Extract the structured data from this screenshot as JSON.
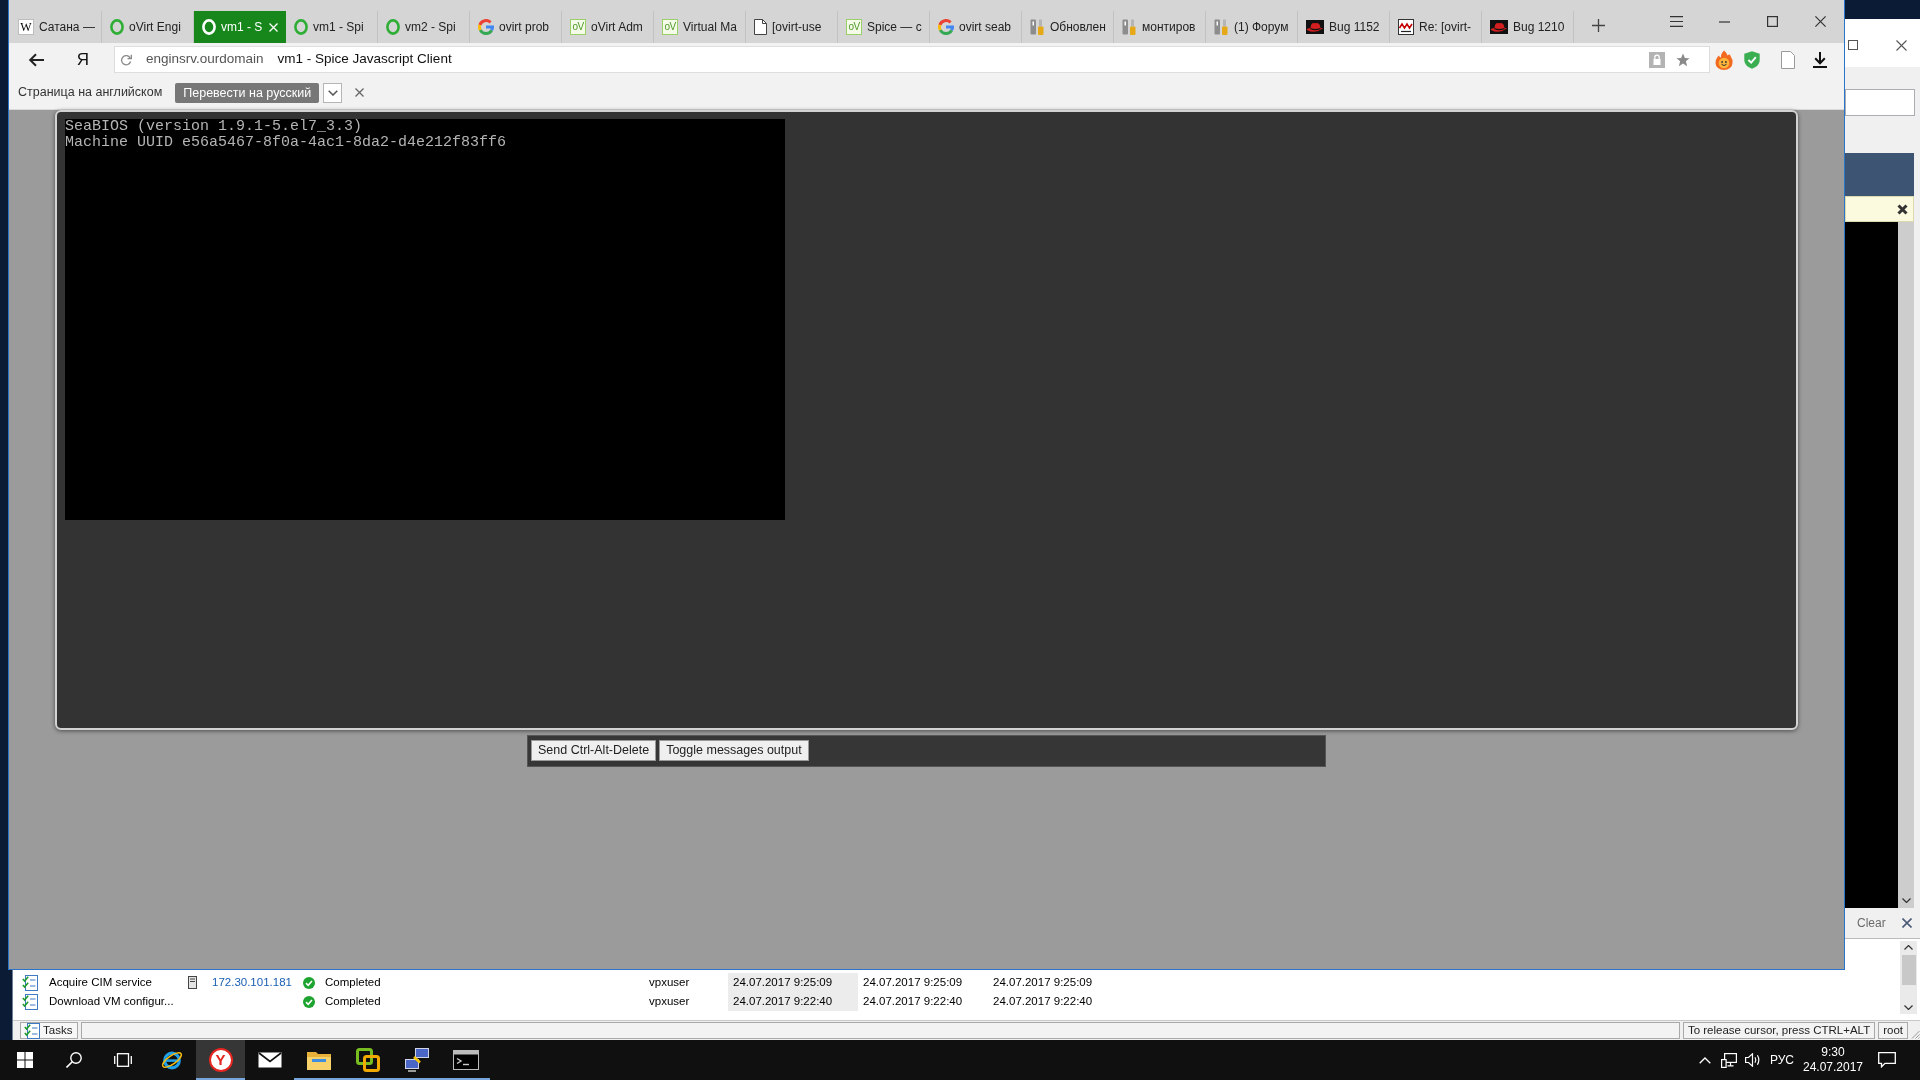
{
  "browser": {
    "tabs": [
      {
        "kind": "letter",
        "glyph": "W",
        "title": "Сатана —",
        "selected": false
      },
      {
        "kind": "ring",
        "title": "oVirt Engi",
        "selected": false
      },
      {
        "kind": "ring",
        "title": "vm1 - S",
        "selected": true
      },
      {
        "kind": "ring",
        "title": "vm1 - Spi",
        "selected": false
      },
      {
        "kind": "ring",
        "title": "vm2 - Spi",
        "selected": false
      },
      {
        "kind": "google",
        "title": "ovirt prob",
        "selected": false
      },
      {
        "kind": "tile",
        "glyph": "oV",
        "title": "oVirt Adm",
        "selected": false
      },
      {
        "kind": "tile",
        "glyph": "oV",
        "title": "Virtual Ma",
        "selected": false
      },
      {
        "kind": "page",
        "title": "[ovirt-use",
        "selected": false
      },
      {
        "kind": "tile",
        "glyph": "oV",
        "title": "Spice — c",
        "selected": false
      },
      {
        "kind": "google",
        "title": "ovirt seab",
        "selected": false
      },
      {
        "kind": "tools",
        "title": "Обновлен",
        "selected": false
      },
      {
        "kind": "tools",
        "title": "монтиров",
        "selected": false
      },
      {
        "kind": "tools",
        "title": "(1) Форум",
        "selected": false
      },
      {
        "kind": "hat",
        "title": "Bug 1152",
        "selected": false
      },
      {
        "kind": "zigzag",
        "title": "Re: [ovirt-",
        "selected": false
      },
      {
        "kind": "hat",
        "title": "Bug 1210",
        "selected": false
      }
    ],
    "address_bar": {
      "logo_button": "Я",
      "host": "enginsrv.ourdomain",
      "page_title": "vm1 - Spice Javascript Client"
    },
    "translate_bar": {
      "message": "Страница на английском",
      "button": "Перевести на русский"
    },
    "page": {
      "console_lines": [
        "SeaBIOS (version 1.9.1-5.el7_3.3)",
        "Machine UUID e56a5467-8f0a-4ac1-8da2-d4e212f83ff6"
      ],
      "buttons": [
        "Send Ctrl-Alt-Delete",
        "Toggle messages output"
      ]
    }
  },
  "background_window": {
    "side_panel": {
      "clear_button": "Clear"
    },
    "tasks": [
      {
        "column_1": "Acquire CIM service",
        "column_2": "172.30.101.181",
        "column_3": "Completed",
        "column_4": "vpxuser",
        "column_5": "24.07.2017 9:25:09",
        "column_6": "24.07.2017 9:25:09",
        "column_7": "24.07.2017 9:25:09"
      },
      {
        "column_1": "Download VM configur...",
        "column_3": "Completed",
        "column_4": "vpxuser",
        "column_5": "24.07.2017 9:22:40",
        "column_6": "24.07.2017 9:22:40",
        "column_7": "24.07.2017 9:22:40"
      }
    ],
    "status_bar": {
      "tab": "Tasks",
      "panes": [
        "To release cursor, press CTRL+ALT",
        "root"
      ]
    }
  },
  "taskbar": {
    "apps": [
      {
        "kind": "ie",
        "running": false,
        "selected": false
      },
      {
        "kind": "yandex",
        "glyph": "Y",
        "running": true,
        "selected": true
      },
      {
        "kind": "mail",
        "running": false,
        "selected": false
      },
      {
        "kind": "folder",
        "running": true,
        "selected": false
      },
      {
        "kind": "vsphere",
        "running": true,
        "selected": false
      },
      {
        "kind": "network",
        "running": true,
        "selected": false
      },
      {
        "kind": "console",
        "running": true,
        "selected": false
      }
    ],
    "tray": {
      "language": "РУС",
      "time": "9:30",
      "date": "24.07.2017"
    }
  }
}
